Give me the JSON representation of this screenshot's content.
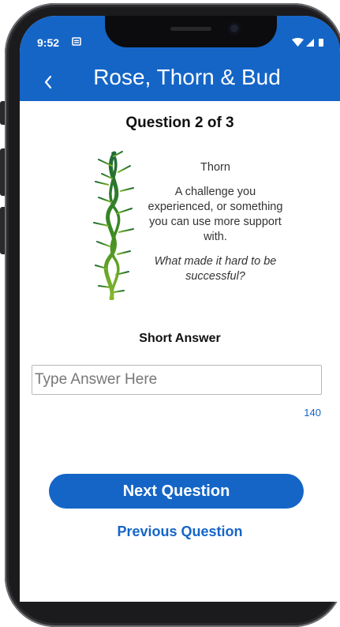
{
  "status": {
    "time": "9:52"
  },
  "header": {
    "title": "Rose, Thorn & Bud"
  },
  "question": {
    "counter": "Question 2 of 3"
  },
  "card": {
    "name": "Thorn",
    "description": "A challenge you experienced, or something you can use more support with.",
    "prompt": "What made it hard to be successful?"
  },
  "answer": {
    "section_label": "Short Answer",
    "placeholder": "Type Answer Here",
    "char_limit": "140"
  },
  "actions": {
    "next_label": "Next Question",
    "previous_label": "Previous Question"
  },
  "colors": {
    "brand_blue": "#1565c7",
    "thorn_green": "#3e8a1e"
  },
  "icons": [
    "back-chevron-icon",
    "notification-icon",
    "wifi-icon",
    "signal-icon",
    "battery-icon"
  ]
}
